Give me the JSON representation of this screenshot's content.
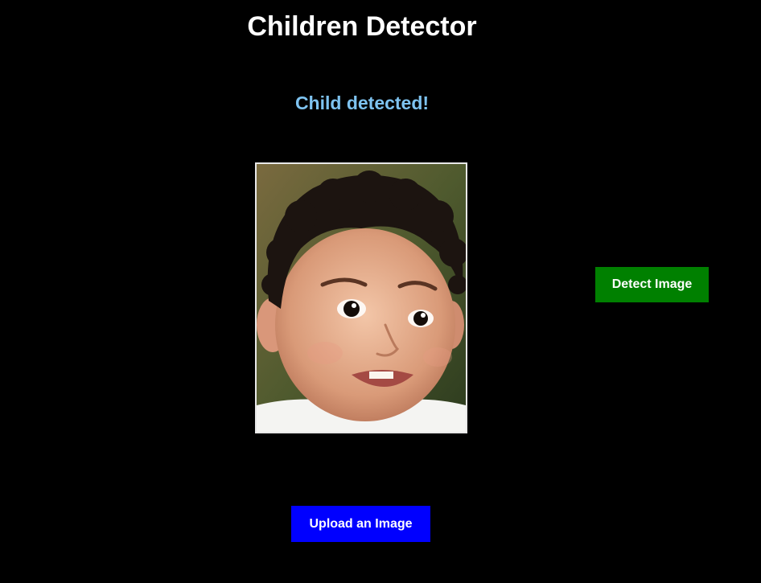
{
  "app": {
    "title": "Children Detector"
  },
  "result": {
    "text": "Child detected!",
    "color": "#7ec3f0"
  },
  "photo": {
    "subject": "toddler face portrait"
  },
  "buttons": {
    "detect_label": "Detect Image",
    "detect_color": "#008000",
    "upload_label": "Upload an Image",
    "upload_color": "#0000ff"
  },
  "theme": {
    "background": "#000000",
    "text": "#ffffff"
  }
}
